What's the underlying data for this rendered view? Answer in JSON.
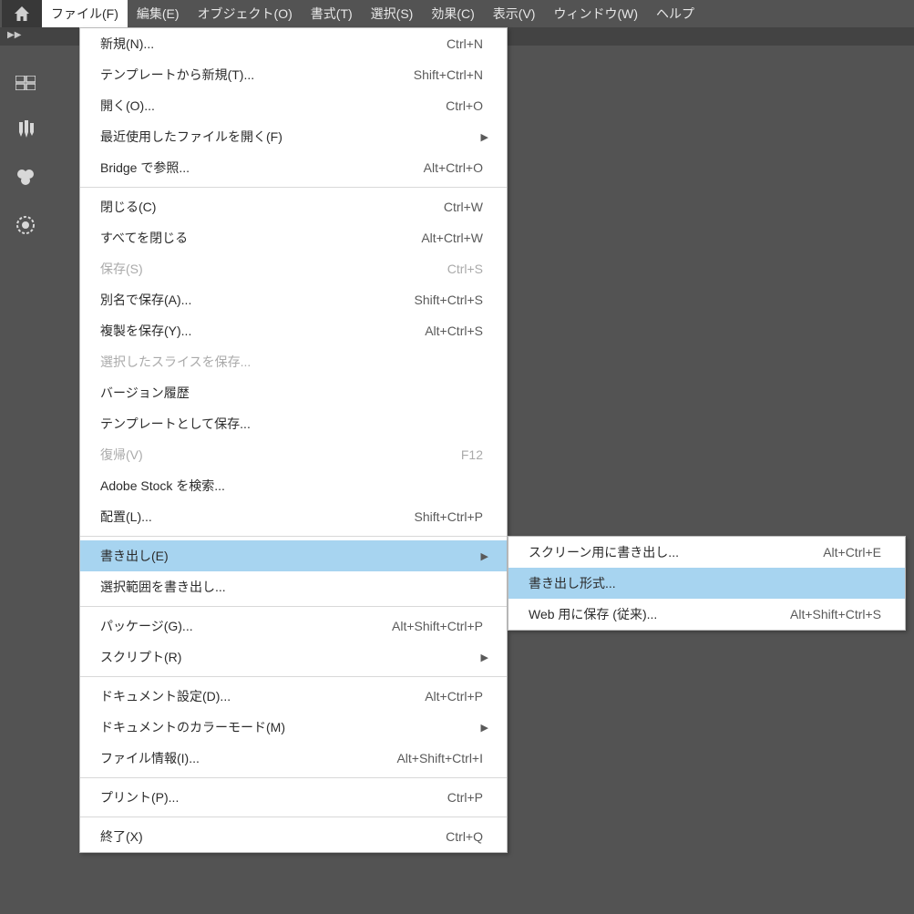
{
  "menubar": {
    "items": [
      "ファイル(F)",
      "編集(E)",
      "オブジェクト(O)",
      "書式(T)",
      "選択(S)",
      "効果(C)",
      "表示(V)",
      "ウィンドウ(W)",
      "ヘルプ"
    ],
    "active_index": 0
  },
  "file_menu": [
    {
      "label": "新規(N)...",
      "shortcut": "Ctrl+N",
      "disabled": false,
      "arrow": false
    },
    {
      "label": "テンプレートから新規(T)...",
      "shortcut": "Shift+Ctrl+N",
      "disabled": false,
      "arrow": false
    },
    {
      "label": "開く(O)...",
      "shortcut": "Ctrl+O",
      "disabled": false,
      "arrow": false
    },
    {
      "label": "最近使用したファイルを開く(F)",
      "shortcut": "",
      "disabled": false,
      "arrow": true
    },
    {
      "label": "Bridge で参照...",
      "shortcut": "Alt+Ctrl+O",
      "disabled": false,
      "arrow": false
    },
    {
      "sep": true
    },
    {
      "label": "閉じる(C)",
      "shortcut": "Ctrl+W",
      "disabled": false,
      "arrow": false
    },
    {
      "label": "すべてを閉じる",
      "shortcut": "Alt+Ctrl+W",
      "disabled": false,
      "arrow": false
    },
    {
      "label": "保存(S)",
      "shortcut": "Ctrl+S",
      "disabled": true,
      "arrow": false
    },
    {
      "label": "別名で保存(A)...",
      "shortcut": "Shift+Ctrl+S",
      "disabled": false,
      "arrow": false
    },
    {
      "label": "複製を保存(Y)...",
      "shortcut": "Alt+Ctrl+S",
      "disabled": false,
      "arrow": false
    },
    {
      "label": "選択したスライスを保存...",
      "shortcut": "",
      "disabled": true,
      "arrow": false
    },
    {
      "label": "バージョン履歴",
      "shortcut": "",
      "disabled": false,
      "arrow": false
    },
    {
      "label": "テンプレートとして保存...",
      "shortcut": "",
      "disabled": false,
      "arrow": false
    },
    {
      "label": "復帰(V)",
      "shortcut": "F12",
      "disabled": true,
      "arrow": false
    },
    {
      "label": "Adobe Stock を検索...",
      "shortcut": "",
      "disabled": false,
      "arrow": false
    },
    {
      "label": "配置(L)...",
      "shortcut": "Shift+Ctrl+P",
      "disabled": false,
      "arrow": false
    },
    {
      "sep": true
    },
    {
      "label": "書き出し(E)",
      "shortcut": "",
      "disabled": false,
      "arrow": true,
      "highlight": true
    },
    {
      "label": "選択範囲を書き出し...",
      "shortcut": "",
      "disabled": false,
      "arrow": false
    },
    {
      "sep": true
    },
    {
      "label": "パッケージ(G)...",
      "shortcut": "Alt+Shift+Ctrl+P",
      "disabled": false,
      "arrow": false
    },
    {
      "label": "スクリプト(R)",
      "shortcut": "",
      "disabled": false,
      "arrow": true
    },
    {
      "sep": true
    },
    {
      "label": "ドキュメント設定(D)...",
      "shortcut": "Alt+Ctrl+P",
      "disabled": false,
      "arrow": false
    },
    {
      "label": "ドキュメントのカラーモード(M)",
      "shortcut": "",
      "disabled": false,
      "arrow": true
    },
    {
      "label": "ファイル情報(I)...",
      "shortcut": "Alt+Shift+Ctrl+I",
      "disabled": false,
      "arrow": false
    },
    {
      "sep": true
    },
    {
      "label": "プリント(P)...",
      "shortcut": "Ctrl+P",
      "disabled": false,
      "arrow": false
    },
    {
      "sep": true
    },
    {
      "label": "終了(X)",
      "shortcut": "Ctrl+Q",
      "disabled": false,
      "arrow": false
    }
  ],
  "export_submenu": [
    {
      "label": "スクリーン用に書き出し...",
      "shortcut": "Alt+Ctrl+E",
      "highlight": false
    },
    {
      "label": "書き出し形式...",
      "shortcut": "",
      "highlight": true
    },
    {
      "label": "Web 用に保存 (従来)...",
      "shortcut": "Alt+Shift+Ctrl+S",
      "highlight": false
    }
  ]
}
